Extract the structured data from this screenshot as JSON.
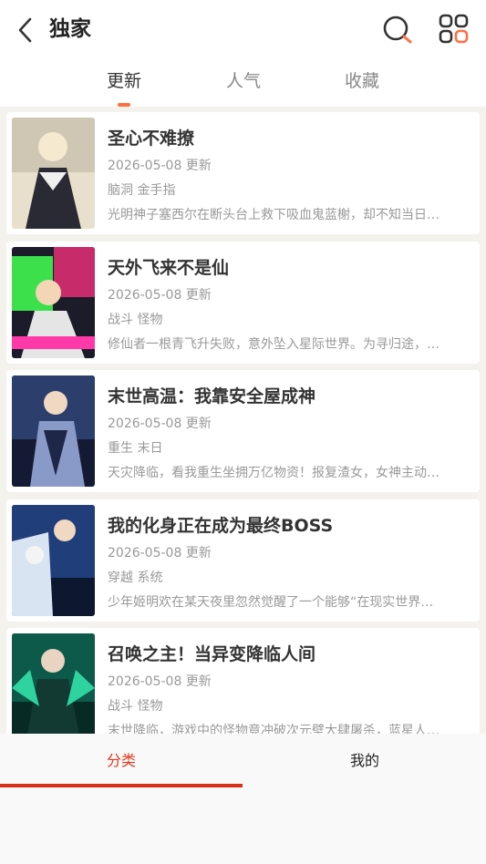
{
  "header": {
    "title": "独家",
    "tabs": [
      "更新",
      "人气",
      "收藏"
    ],
    "active_tab": 0
  },
  "books": [
    {
      "title": "圣心不难撩",
      "date": "2026-05-08 更新",
      "tags": "脑洞 金手指",
      "desc": "光明神子塞西尔在断头台上救下吸血鬼蓝榭，却不知当日…",
      "cover_colors": [
        "#cfc7b4",
        "#2a2a35",
        "#e8e0cc"
      ]
    },
    {
      "title": "天外飞来不是仙",
      "date": "2026-05-08 更新",
      "tags": "战斗 怪物",
      "desc": "修仙者一根青飞升失败，意外坠入星际世界。为寻归途，…",
      "cover_colors": [
        "#3be04b",
        "#c72b6a",
        "#1b1b2a"
      ]
    },
    {
      "title": "末世高温：我靠安全屋成神",
      "date": "2026-05-08 更新",
      "tags": "重生 末日",
      "desc": "天灾降临，看我重生坐拥万亿物资！报复渣女，女神主动…",
      "cover_colors": [
        "#2c3e6b",
        "#8a9ac8",
        "#141a33"
      ]
    },
    {
      "title": "我的化身正在成为最终BOSS",
      "date": "2026-05-08 更新",
      "tags": "穿越 系统",
      "desc": "少年姬明欢在某天夜里忽然觉醒了一个能够“在现实世界…",
      "cover_colors": [
        "#1f3e7a",
        "#d9e4f2",
        "#0d1730"
      ]
    },
    {
      "title": "召唤之主！当异变降临人间",
      "date": "2026-05-08 更新",
      "tags": "战斗 怪物",
      "desc": "末世降临，游戏中的怪物竟冲破次元壁大肆屠杀，蓝星人…",
      "cover_colors": [
        "#0e5a4a",
        "#2fd3a0",
        "#082a24"
      ]
    }
  ],
  "bottom_nav": {
    "items": [
      "分类",
      "我的"
    ],
    "active": 0
  },
  "colors": {
    "accent": "#ff7043",
    "nav_active": "#e0391e",
    "background": "#f4f2ec"
  },
  "icons": {
    "back": "chevron-left-icon",
    "search": "search-icon",
    "grid": "grid-icon"
  }
}
